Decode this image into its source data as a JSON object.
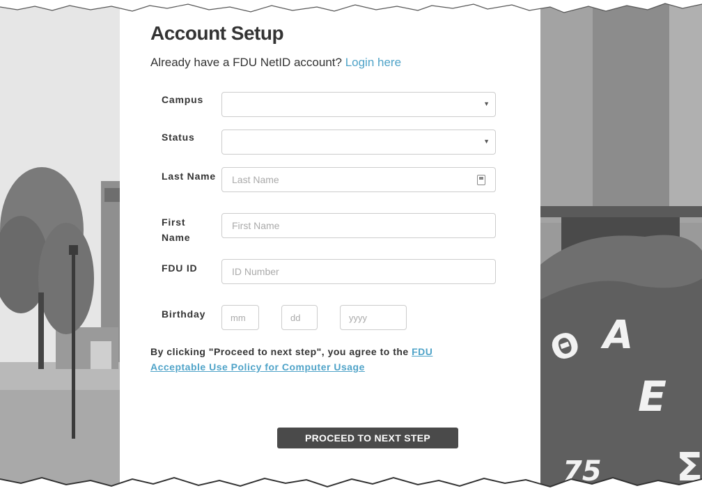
{
  "form": {
    "title": "Account Setup",
    "subtitle_text": "Already have a FDU NetID account? ",
    "login_link": "Login here",
    "fields": {
      "campus": {
        "label": "Campus",
        "value": ""
      },
      "status": {
        "label": "Status",
        "value": ""
      },
      "last_name": {
        "label": "Last Name",
        "placeholder": "Last Name"
      },
      "first_name": {
        "label": "First Name",
        "placeholder": "First Name"
      },
      "fdu_id": {
        "label": "FDU ID",
        "placeholder": "ID Number"
      },
      "birthday": {
        "label": "Birthday",
        "mm": "mm",
        "dd": "dd",
        "yyyy": "yyyy"
      }
    },
    "agreement_text": "By clicking \"Proceed to next step\", you agree to the ",
    "policy_link": "FDU Acceptable Use Policy for Computer Usage",
    "proceed_label": "PROCEED TO NEXT STEP"
  },
  "images": {
    "right_rock_letters": [
      "Θ",
      "A",
      "E",
      "75",
      "Σ"
    ]
  },
  "colors": {
    "link": "#4fa3c8",
    "button_bg": "#4a4a4a",
    "text": "#333333"
  }
}
